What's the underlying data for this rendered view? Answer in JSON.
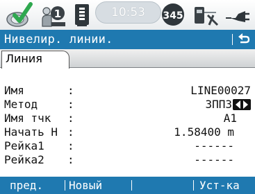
{
  "status_bar": {
    "time": "10:53",
    "satellite_count": "345",
    "icons": [
      "survey-ok-icon",
      "user-account-icon",
      "memory-card-icon",
      "satellite-icon",
      "level-instrument-icon",
      "power-plug-icon"
    ],
    "badge_number": "1"
  },
  "title_bar": {
    "title": "Нивелир.  линии.",
    "back_icon": "return-arrow-icon"
  },
  "tabs": [
    {
      "label": "Линия"
    }
  ],
  "form": {
    "rows": [
      {
        "label": "Имя",
        "value": "LINE00027"
      },
      {
        "label": "Метод",
        "value": "ЗППЗ"
      },
      {
        "label": "Имя тчк",
        "value": "A1"
      },
      {
        "label": "Начать H",
        "value": "1.58400 m"
      },
      {
        "label": "Рейка1",
        "value": "------"
      },
      {
        "label": "Рейка2",
        "value": "------"
      }
    ]
  },
  "softkeys": {
    "prev": "пред.",
    "new": "Новый",
    "empty": "",
    "settings": "Уст-ка"
  },
  "colors": {
    "accent": "#1f79b0",
    "background": "#ffffff",
    "check_green": "#2fa84f"
  }
}
